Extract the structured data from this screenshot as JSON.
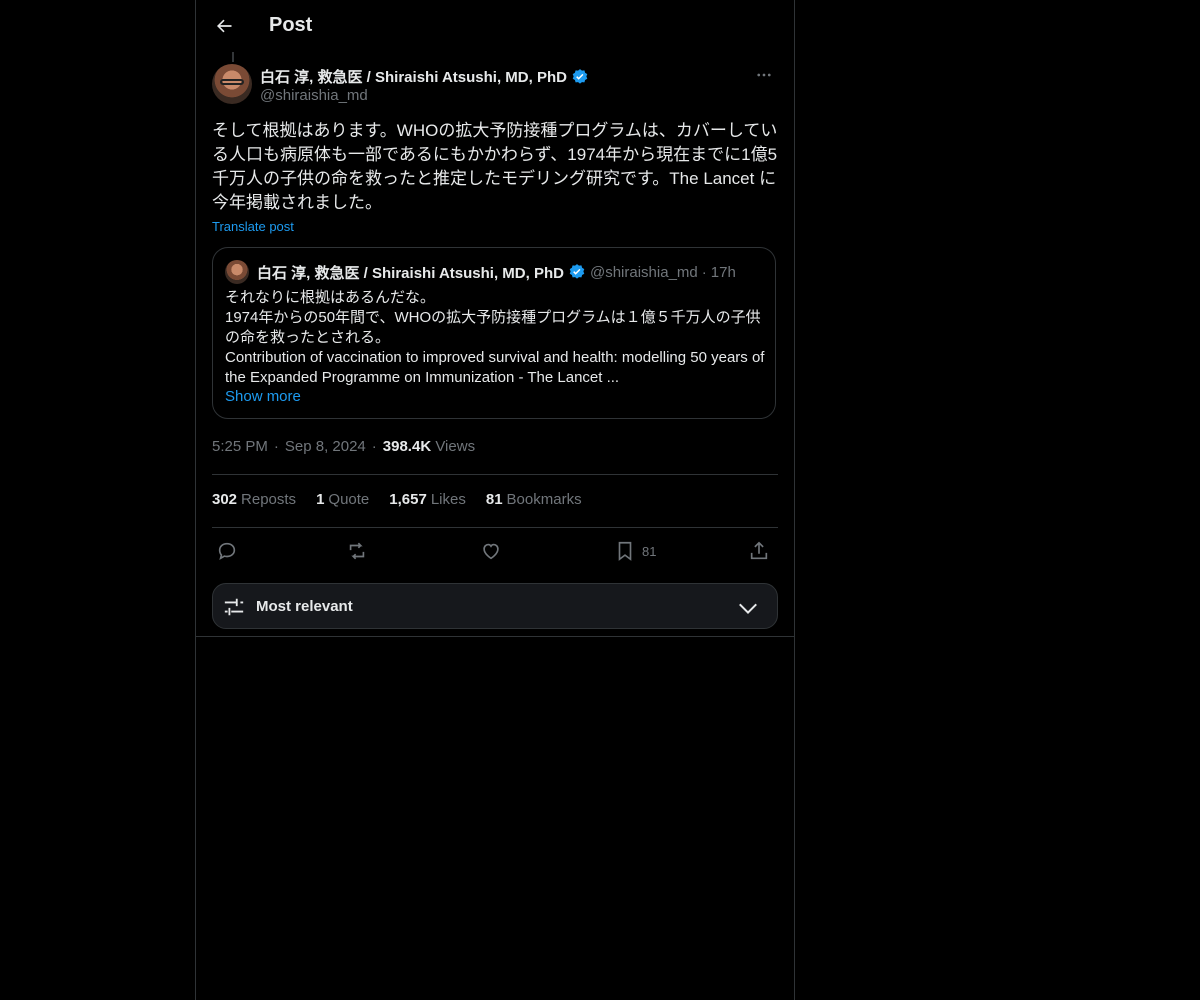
{
  "header": {
    "title": "Post"
  },
  "post": {
    "author_name": "白石 淳, 救急医 / Shiraishi Atsushi, MD, PhD",
    "author_handle": "@shiraishia_md",
    "text": "そして根拠はあります。WHOの拡大予防接種プログラムは、カバーしている人口も病原体も一部であるにもかかわらず、1974年から現在までに1億5千万人の子供の命を救ったと推定したモデリング研究です。The Lancet に今年掲載されました。",
    "translate_label": "Translate post",
    "time": "5:25 PM",
    "date": "Sep 8, 2024",
    "dot": "·",
    "views_count": "398.4K",
    "views_label": "Views"
  },
  "quote": {
    "author_name": "白石 淳, 救急医 / Shiraishi Atsushi, MD, PhD",
    "author_handle": "@shiraishia_md",
    "dot": "·",
    "time": "17h",
    "text": "それなりに根拠はあるんだな。\n1974年からの50年間で、WHOの拡大予防接種プログラムは１億５千万人の子供の命を救ったとされる。\nContribution of vaccination to improved survival and health: modelling 50 years of the Expanded Programme on Immunization - The Lancet ...",
    "show_more": "Show more"
  },
  "stats": {
    "reposts_count": "302",
    "reposts_label": "Reposts",
    "quotes_count": "1",
    "quotes_label": "Quote",
    "likes_count": "1,657",
    "likes_label": "Likes",
    "bookmarks_count": "81",
    "bookmarks_label": "Bookmarks"
  },
  "actions": {
    "bookmark_count": "81"
  },
  "sort": {
    "label": "Most relevant"
  },
  "colors": {
    "accent": "#1d9bf0",
    "muted": "#71767b",
    "border": "#2f3336"
  }
}
